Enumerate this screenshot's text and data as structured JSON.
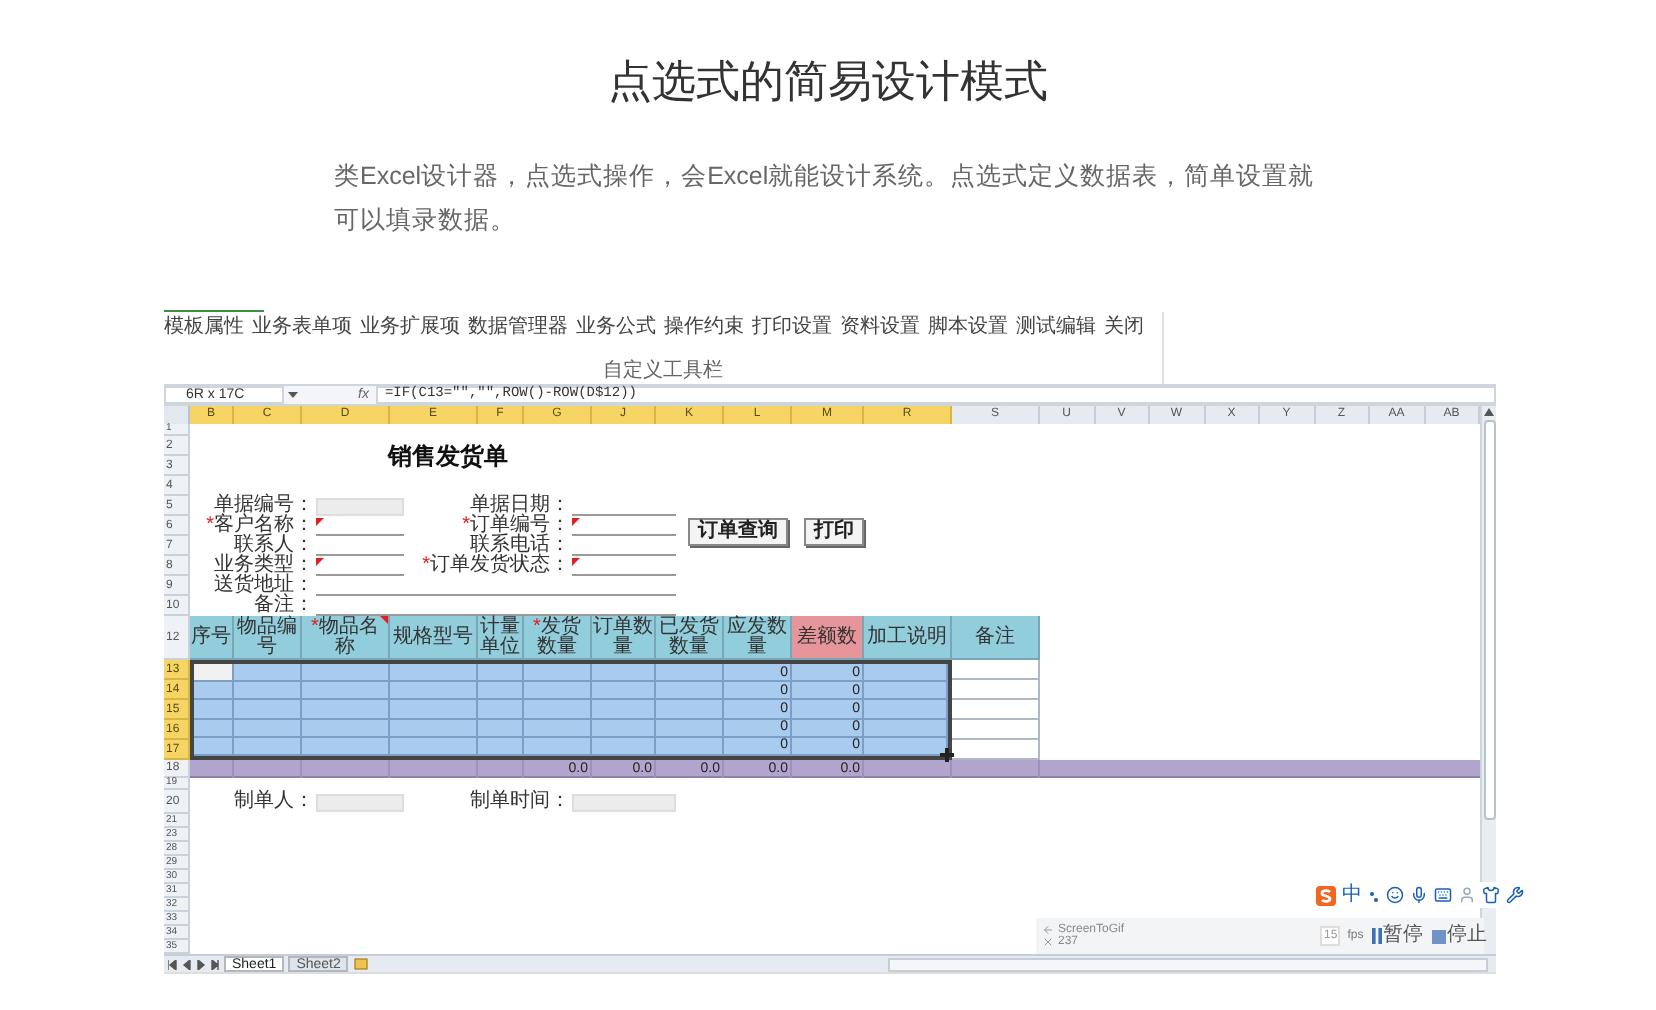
{
  "heading": "点选式的简易设计模式",
  "intro": "类Excel设计器，点选式操作，会Excel就能设计系统。点选式定义数据表，简单设置就可以填录数据。",
  "designer": {
    "ribbon": {
      "menu": [
        "模板属性",
        "业务表单项",
        "业务扩展项",
        "数据管理器",
        "业务公式",
        "操作约束",
        "打印设置",
        "资料设置",
        "脚本设置",
        "测试编辑",
        "关闭"
      ],
      "group_label": "自定义工具栏"
    },
    "formula_bar": {
      "name_box": "6R x 17C",
      "function_label": "fx",
      "formula": "=IF(C13=\"\",\"\",ROW()-ROW(D$12))"
    },
    "columns": [
      {
        "label": "B",
        "selected": true
      },
      {
        "label": "C",
        "selected": true
      },
      {
        "label": "D",
        "selected": true
      },
      {
        "label": "E",
        "selected": true
      },
      {
        "label": "F",
        "selected": true
      },
      {
        "label": "G",
        "selected": true
      },
      {
        "label": "J",
        "selected": true
      },
      {
        "label": "K",
        "selected": true
      },
      {
        "label": "L",
        "selected": true
      },
      {
        "label": "M",
        "selected": true
      },
      {
        "label": "R",
        "selected": true
      },
      {
        "label": "S",
        "selected": false
      },
      {
        "label": "U",
        "selected": false
      },
      {
        "label": "V",
        "selected": false
      },
      {
        "label": "W",
        "selected": false
      },
      {
        "label": "X",
        "selected": false
      },
      {
        "label": "Y",
        "selected": false
      },
      {
        "label": "Z",
        "selected": false
      },
      {
        "label": "AA",
        "selected": false
      },
      {
        "label": "AB",
        "selected": false
      }
    ],
    "row_headers": [
      {
        "label": "1",
        "selected": false
      },
      {
        "label": "2",
        "selected": false
      },
      {
        "label": "3",
        "selected": false
      },
      {
        "label": "4",
        "selected": false
      },
      {
        "label": "5",
        "selected": false
      },
      {
        "label": "6",
        "selected": false
      },
      {
        "label": "7",
        "selected": false
      },
      {
        "label": "8",
        "selected": false
      },
      {
        "label": "9",
        "selected": false
      },
      {
        "label": "10",
        "selected": false
      },
      {
        "label": "12",
        "selected": false
      },
      {
        "label": "13",
        "selected": true
      },
      {
        "label": "14",
        "selected": true
      },
      {
        "label": "15",
        "selected": true
      },
      {
        "label": "16",
        "selected": true
      },
      {
        "label": "17",
        "selected": true
      },
      {
        "label": "18",
        "selected": false
      },
      {
        "label": "19",
        "selected": false
      },
      {
        "label": "20",
        "selected": false
      },
      {
        "label": "21",
        "selected": false
      },
      {
        "label": "23",
        "selected": false
      },
      {
        "label": "28",
        "selected": false
      },
      {
        "label": "29",
        "selected": false
      },
      {
        "label": "30",
        "selected": false
      },
      {
        "label": "31",
        "selected": false
      },
      {
        "label": "32",
        "selected": false
      },
      {
        "label": "33",
        "selected": false
      },
      {
        "label": "34",
        "selected": false
      },
      {
        "label": "35",
        "selected": false
      }
    ],
    "form": {
      "title": "销售发货单",
      "rows": [
        {
          "left": {
            "label": "单据编号：",
            "kind": "readonly",
            "flagged": false
          },
          "right": {
            "label": "单据日期：",
            "kind": "line",
            "flagged": false
          }
        },
        {
          "left": {
            "mark": "*",
            "label": "客户名称：",
            "kind": "line",
            "flagged": true
          },
          "right": {
            "mark": "*",
            "label": "订单编号：",
            "kind": "line",
            "flagged": true
          }
        },
        {
          "left": {
            "label": "联系人：",
            "kind": "line",
            "flagged": false
          },
          "right": {
            "label": "联系电话：",
            "kind": "line",
            "flagged": false
          }
        },
        {
          "left": {
            "label": "业务类型：",
            "kind": "line",
            "flagged": true
          },
          "right": {
            "mark": "*",
            "label": "订单发货状态：",
            "kind": "line",
            "flagged": true
          }
        },
        {
          "left": {
            "label": "送货地址：",
            "kind": "line",
            "flagged": false
          }
        },
        {
          "left": {
            "label": "备注：",
            "kind": "line",
            "flagged": false
          }
        }
      ],
      "buttons": [
        "订单查询",
        "打印"
      ]
    },
    "table": {
      "columns": [
        {
          "label": "序号",
          "kind": "entry",
          "color": "#92cddc"
        },
        {
          "label": "物品编号",
          "kind": "entry",
          "color": "#92cddc"
        },
        {
          "mark": "*",
          "label": "物品名称",
          "kind": "entry",
          "color": "#92cddc",
          "flagged": true
        },
        {
          "label": "规格型号",
          "kind": "entry",
          "color": "#92cddc"
        },
        {
          "label": "计量单位",
          "kind": "entry",
          "color": "#92cddc"
        },
        {
          "mark": "*",
          "label": "发货数量",
          "kind": "entry",
          "color": "#92cddc",
          "total": "0.0"
        },
        {
          "label": "订单数量",
          "kind": "entry",
          "color": "#92cddc",
          "total": "0.0"
        },
        {
          "label": "已发货数量",
          "kind": "entry",
          "color": "#92cddc",
          "total": "0.0"
        },
        {
          "label": "应发数量",
          "kind": "due",
          "color": "#92cddc",
          "total": "0.0"
        },
        {
          "label": "差额数",
          "kind": "difference",
          "color": "#e6959b",
          "total": "0.0"
        },
        {
          "label": "加工说明",
          "kind": "entry",
          "color": "#92cddc"
        },
        {
          "label": "备注",
          "kind": "note",
          "color": "#92cddc"
        }
      ],
      "rows": [
        {
          "active": true,
          "due": "0",
          "difference": "0"
        },
        {
          "active": false,
          "due": "0",
          "difference": "0"
        },
        {
          "active": false,
          "due": "0",
          "difference": "0"
        },
        {
          "active": false,
          "due": "0",
          "difference": "0"
        },
        {
          "active": false,
          "due": "0",
          "difference": "0"
        }
      ]
    },
    "footer_form": [
      {
        "label": "制单人：",
        "kind": "readonly"
      },
      {
        "label": "制单时间：",
        "kind": "readonly"
      }
    ],
    "sheet_tabs": [
      {
        "label": "Sheet1",
        "selected": true
      },
      {
        "label": "Sheet2",
        "selected": false
      }
    ],
    "ime_toolbar": {
      "mode": "中"
    },
    "recorder": {
      "title": "ScreenToGif",
      "frame": "237",
      "fps_value": "15",
      "fps_unit": "fps",
      "pause": "暂停",
      "stop": "停止"
    }
  }
}
